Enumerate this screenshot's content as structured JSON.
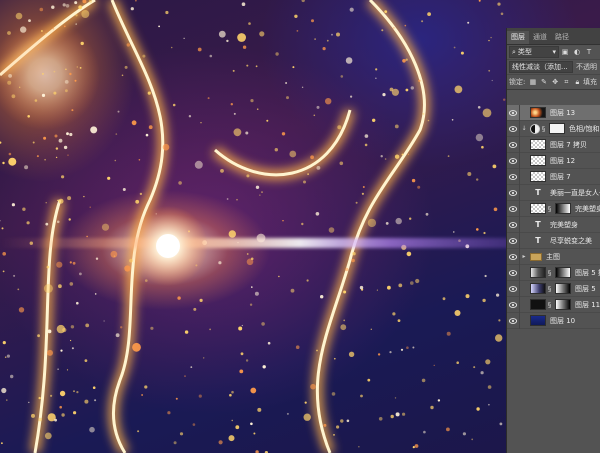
{
  "panel": {
    "tabs": [
      "图层",
      "通道",
      "路径"
    ],
    "filter_kind": "类型",
    "filter_icons": [
      "image-filter-icon",
      "adjustment-filter-icon",
      "type-filter-icon"
    ],
    "blend_mode": "线性减淡（添加...",
    "opacity_label": "不透明",
    "lock_label": "锁定:",
    "fill_label": "填充"
  },
  "layers": [
    {
      "name": "图层 13",
      "kind": "pixel",
      "selected": true
    },
    {
      "name": "色相/饱和",
      "kind": "adjustment",
      "clipped": true
    },
    {
      "name": "图层 7 拷贝",
      "kind": "pixel"
    },
    {
      "name": "图层 12",
      "kind": "pixel"
    },
    {
      "name": "图层 7",
      "kind": "pixel"
    },
    {
      "name": "美丽一直是女人一",
      "kind": "type"
    },
    {
      "name": "完美塑身",
      "kind": "pixel-mask"
    },
    {
      "name": "完美塑身",
      "kind": "type"
    },
    {
      "name": "尽享蜕变之美",
      "kind": "type"
    },
    {
      "name": "主图",
      "kind": "group"
    },
    {
      "name": "图层 5 拷",
      "kind": "pixel-mask"
    },
    {
      "name": "图层 5",
      "kind": "pixel-mask"
    },
    {
      "name": "图层 11",
      "kind": "pixel-mask"
    },
    {
      "name": "图层 10",
      "kind": "pixel"
    }
  ],
  "colors": {
    "panel_bg": "#535353",
    "selected_row": "#6f6f6f",
    "glow": "#ffcf70"
  }
}
